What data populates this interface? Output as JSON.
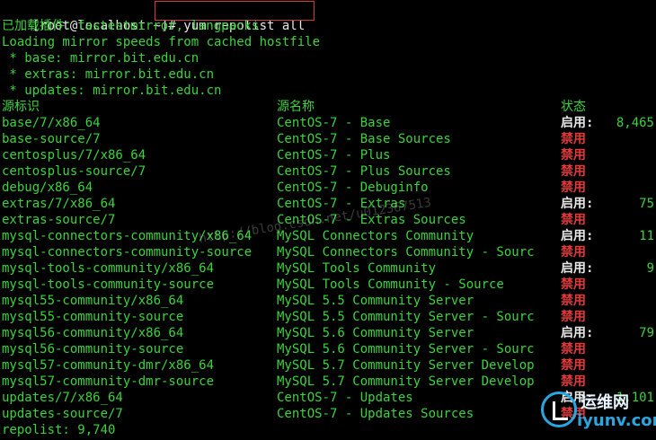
{
  "prompt": {
    "text": "[root@localhost ~]# ",
    "command": "yum repolist all"
  },
  "output_lines": [
    "已加载插件：fastestmirror, langpacks",
    "Loading mirror speeds from cached hostfile",
    " * base: mirror.bit.edu.cn",
    " * extras: mirror.bit.edu.cn",
    " * updates: mirror.bit.edu.cn"
  ],
  "table": {
    "headers": {
      "id": "源标识",
      "name": "源名称",
      "status": "状态"
    },
    "rows": [
      {
        "id": "base/7/x86_64",
        "name": "CentOS-7 - Base",
        "status": "启用:",
        "count": "8,465",
        "enabled": true
      },
      {
        "id": "base-source/7",
        "name": "CentOS-7 - Base Sources",
        "status": "禁用",
        "count": "",
        "enabled": false
      },
      {
        "id": "centosplus/7/x86_64",
        "name": "CentOS-7 - Plus",
        "status": "禁用",
        "count": "",
        "enabled": false
      },
      {
        "id": "centosplus-source/7",
        "name": "CentOS-7 - Plus Sources",
        "status": "禁用",
        "count": "",
        "enabled": false
      },
      {
        "id": "debug/x86_64",
        "name": "CentOS-7 - Debuginfo",
        "status": "禁用",
        "count": "",
        "enabled": false
      },
      {
        "id": "extras/7/x86_64",
        "name": "CentOS-7 - Extras",
        "status": "启用:",
        "count": "75",
        "enabled": true
      },
      {
        "id": "extras-source/7",
        "name": "CentOS-7 - Extras Sources",
        "status": "禁用",
        "count": "",
        "enabled": false
      },
      {
        "id": "mysql-connectors-community/x86_64",
        "name": "MySQL Connectors Community",
        "status": "启用:",
        "count": "11",
        "enabled": true
      },
      {
        "id": "mysql-connectors-community-source",
        "name": "MySQL Connectors Community - Sourc",
        "status": "禁用",
        "count": "",
        "enabled": false
      },
      {
        "id": "mysql-tools-community/x86_64",
        "name": "MySQL Tools Community",
        "status": "启用:",
        "count": "9",
        "enabled": true
      },
      {
        "id": "mysql-tools-community-source",
        "name": "MySQL Tools Community - Source",
        "status": "禁用",
        "count": "",
        "enabled": false
      },
      {
        "id": "mysql55-community/x86_64",
        "name": "MySQL 5.5 Community Server",
        "status": "禁用",
        "count": "",
        "enabled": false
      },
      {
        "id": "mysql55-community-source",
        "name": "MySQL 5.5 Community Server - Sourc",
        "status": "禁用",
        "count": "",
        "enabled": false
      },
      {
        "id": "mysql56-community/x86_64",
        "name": "MySQL 5.6 Community Server",
        "status": "启用:",
        "count": "79",
        "enabled": true
      },
      {
        "id": "mysql56-community-source",
        "name": "MySQL 5.6 Community Server - Sourc",
        "status": "禁用",
        "count": "",
        "enabled": false
      },
      {
        "id": "mysql57-community-dmr/x86_64",
        "name": "MySQL 5.7 Community Server Develop",
        "status": "禁用",
        "count": "",
        "enabled": false
      },
      {
        "id": "mysql57-community-dmr-source",
        "name": "MySQL 5.7 Community Server Develop",
        "status": "禁用",
        "count": "",
        "enabled": false
      },
      {
        "id": "updates/7/x86_64",
        "name": "CentOS-7 - Updates",
        "status": "启用:",
        "count": "1,101",
        "enabled": true
      },
      {
        "id": "updates-source/7",
        "name": "CentOS-7 - Updates Sources",
        "status": "禁用",
        "count": "",
        "enabled": false
      }
    ]
  },
  "footer": "repolist: 9,740",
  "watermark": "http://blog.csdn.net/u012367513",
  "logo": {
    "cn": "运维网",
    "en": "iyunv.com"
  },
  "colors": {
    "green": "#3ad43a",
    "red": "#e03a3a",
    "white": "#e8e8e8",
    "background": "#000000"
  }
}
